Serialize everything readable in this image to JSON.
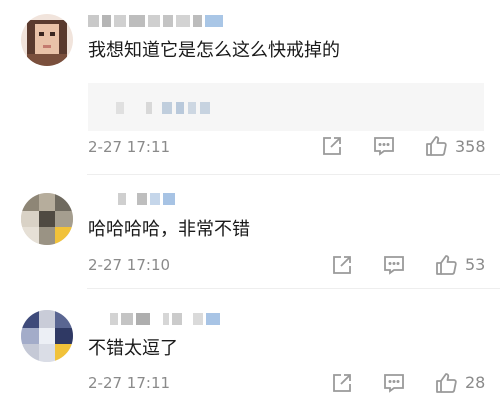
{
  "comments": [
    {
      "text": "我想知道它是怎么这么快戒掉的",
      "time": "2-27 17:11",
      "likes": "358",
      "has_reply_preview": true
    },
    {
      "text": "哈哈哈哈，非常不错",
      "time": "2-27 17:10",
      "likes": "53",
      "has_reply_preview": false
    },
    {
      "text": "不错太逗了",
      "time": "2-27 17:11",
      "likes": "28",
      "has_reply_preview": false
    }
  ],
  "icons": {
    "share": "share-icon",
    "reply": "comment-icon",
    "like": "thumbs-up-icon"
  },
  "colors": {
    "text": "#1a1a1a",
    "meta": "#8a8a8a",
    "icon": "#9a9a9a",
    "reply_bg": "#f6f6f6"
  }
}
